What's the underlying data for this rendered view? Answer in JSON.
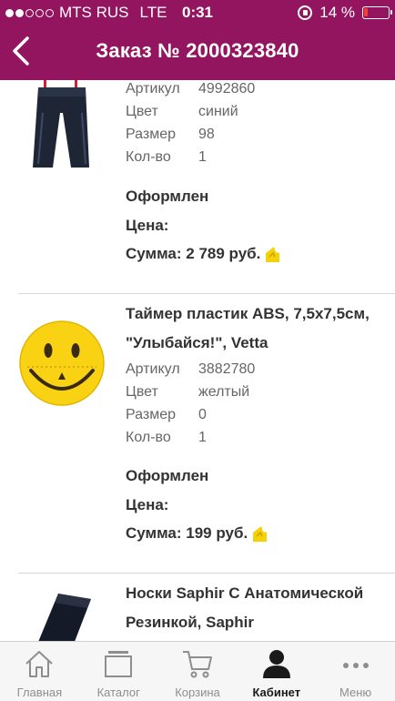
{
  "status_bar": {
    "carrier": "MTS RUS",
    "network": "LTE",
    "time": "0:31",
    "battery": "14 %",
    "battery_level": 0.14,
    "signal_bars_filled": 2
  },
  "header": {
    "title": "Заказ № 2000323840"
  },
  "colors": {
    "brand": "#93155f",
    "coin": "#f5d10a"
  },
  "items": [
    {
      "name": "",
      "props": [
        {
          "key": "Артикул",
          "value": "4992860"
        },
        {
          "key": "Цвет",
          "value": "синий"
        },
        {
          "key": "Размер",
          "value": "98"
        },
        {
          "key": "Кол-во",
          "value": "1"
        }
      ],
      "status": "Оформлен",
      "price_label": "Цена:",
      "sum": "Сумма: 2 789 руб.",
      "thumb_icon": "pants-image"
    },
    {
      "name": "Таймер пластик ABS, 7,5х7,5см, \"Улыбайся!\", Vetta",
      "props": [
        {
          "key": "Артикул",
          "value": "3882780"
        },
        {
          "key": "Цвет",
          "value": "желтый"
        },
        {
          "key": "Размер",
          "value": "0"
        },
        {
          "key": "Кол-во",
          "value": "1"
        }
      ],
      "status": "Оформлен",
      "price_label": "Цена:",
      "sum": "Сумма: 199 руб.",
      "thumb_icon": "smiley-timer-image"
    },
    {
      "name": "Носки Saphir С Анатомической Резинкой, Saphir",
      "thumb_icon": "socks-image"
    }
  ],
  "tabbar": [
    {
      "label": "Главная",
      "icon": "home-icon",
      "active": false
    },
    {
      "label": "Каталог",
      "icon": "catalog-icon",
      "active": false
    },
    {
      "label": "Корзина",
      "icon": "cart-icon",
      "active": false
    },
    {
      "label": "Кабинет",
      "icon": "user-icon",
      "active": true
    },
    {
      "label": "Меню",
      "icon": "more-icon",
      "active": false
    }
  ]
}
